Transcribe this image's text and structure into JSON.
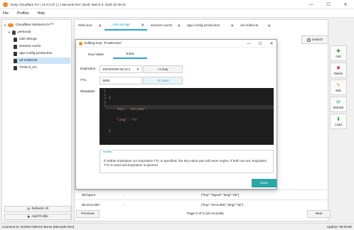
{
  "window": {
    "title": "Easy Cloudflare KV | v3.0.0.37 (.) | Mecanik Dev | Built: March 9, 2026 @ 05:15",
    "controls": [
      "—",
      "☐",
      "✕"
    ]
  },
  "menu": [
    "File",
    "Profiles",
    "Help"
  ],
  "sidebar": {
    "root": "Cloudflare Workers KV™",
    "profile": "personal",
    "namespaces": [
      "i18n-strings",
      "session-cache",
      "app-config-production",
      "url-redirects",
      "TOOLS_KV"
    ],
    "refresh_all": "Refresh All",
    "add_profile": "Add Profile"
  },
  "tabs": [
    {
      "label": "Welcome"
    },
    {
      "label": "i18n-strings"
    },
    {
      "label": "session-cache"
    },
    {
      "label": "app-config-production"
    },
    {
      "label": "url-redirects"
    }
  ],
  "search": {
    "label": "Search"
  },
  "grid": {
    "rows": [
      {
        "key": "de:logout",
        "expiration": "-",
        "value": "{\"key\":\"logout\",\"lang\":\"de\"}"
      },
      {
        "key": "de:error.500",
        "expiration": "-",
        "value": "{\"key\":\"error.500\",\"lang\":\"de\"}"
      }
    ]
  },
  "pager": {
    "previous": "Previous",
    "next": "Next",
    "info": "Page 0 of 0 (16 records)"
  },
  "actions": [
    {
      "label": "Add",
      "icon": "plus-icon",
      "glyph": "✚",
      "color": "#2e9e2e"
    },
    {
      "label": "Delete",
      "icon": "delete-icon",
      "glyph": "✖",
      "color": "#d23030"
    },
    {
      "label": "Edit",
      "icon": "pencil-icon",
      "glyph": "✎",
      "color": "#e08a1e"
    },
    {
      "label": "Refresh",
      "icon": "refresh-icon",
      "glyph": "⟳",
      "color": "#2e9e2e"
    },
    {
      "label": "Load",
      "icon": "load-icon",
      "glyph": "⬇",
      "color": "#2e9e2e"
    }
  ],
  "status": {
    "license": "Licensed to: Norbert Elemer Boros (Mecanik Dev)",
    "uptime": "Uptime: 00:00:50"
  },
  "dialog": {
    "title": "Editing Key: 'fr:welcome'",
    "tabs": [
      "Key-Value",
      "Extra"
    ],
    "expiration_label": "Expiration:",
    "expiration_value": "10/03/2026 05:12:1",
    "plus_day": "+1 Day",
    "ttl_label": "TTL:",
    "ttl_value": "3600",
    "plus_hour": "+1 Hour",
    "metadata_label": "Metadata:",
    "metadata_lines": [
      "{",
      "    \"key\": \"welcome\",",
      "    \"lang\": \"fr\"",
      "}",
      ""
    ],
    "line_numbers": [
      "1",
      "2",
      "3",
      "4",
      "5"
    ],
    "notes_title": "Notes",
    "notes_text": "If neither Expiration nor Expiration TTL is specified, the key-value pair will never expire. If both are set, Expiration TTL is used and Expiration is ignored.",
    "save": "Save"
  }
}
